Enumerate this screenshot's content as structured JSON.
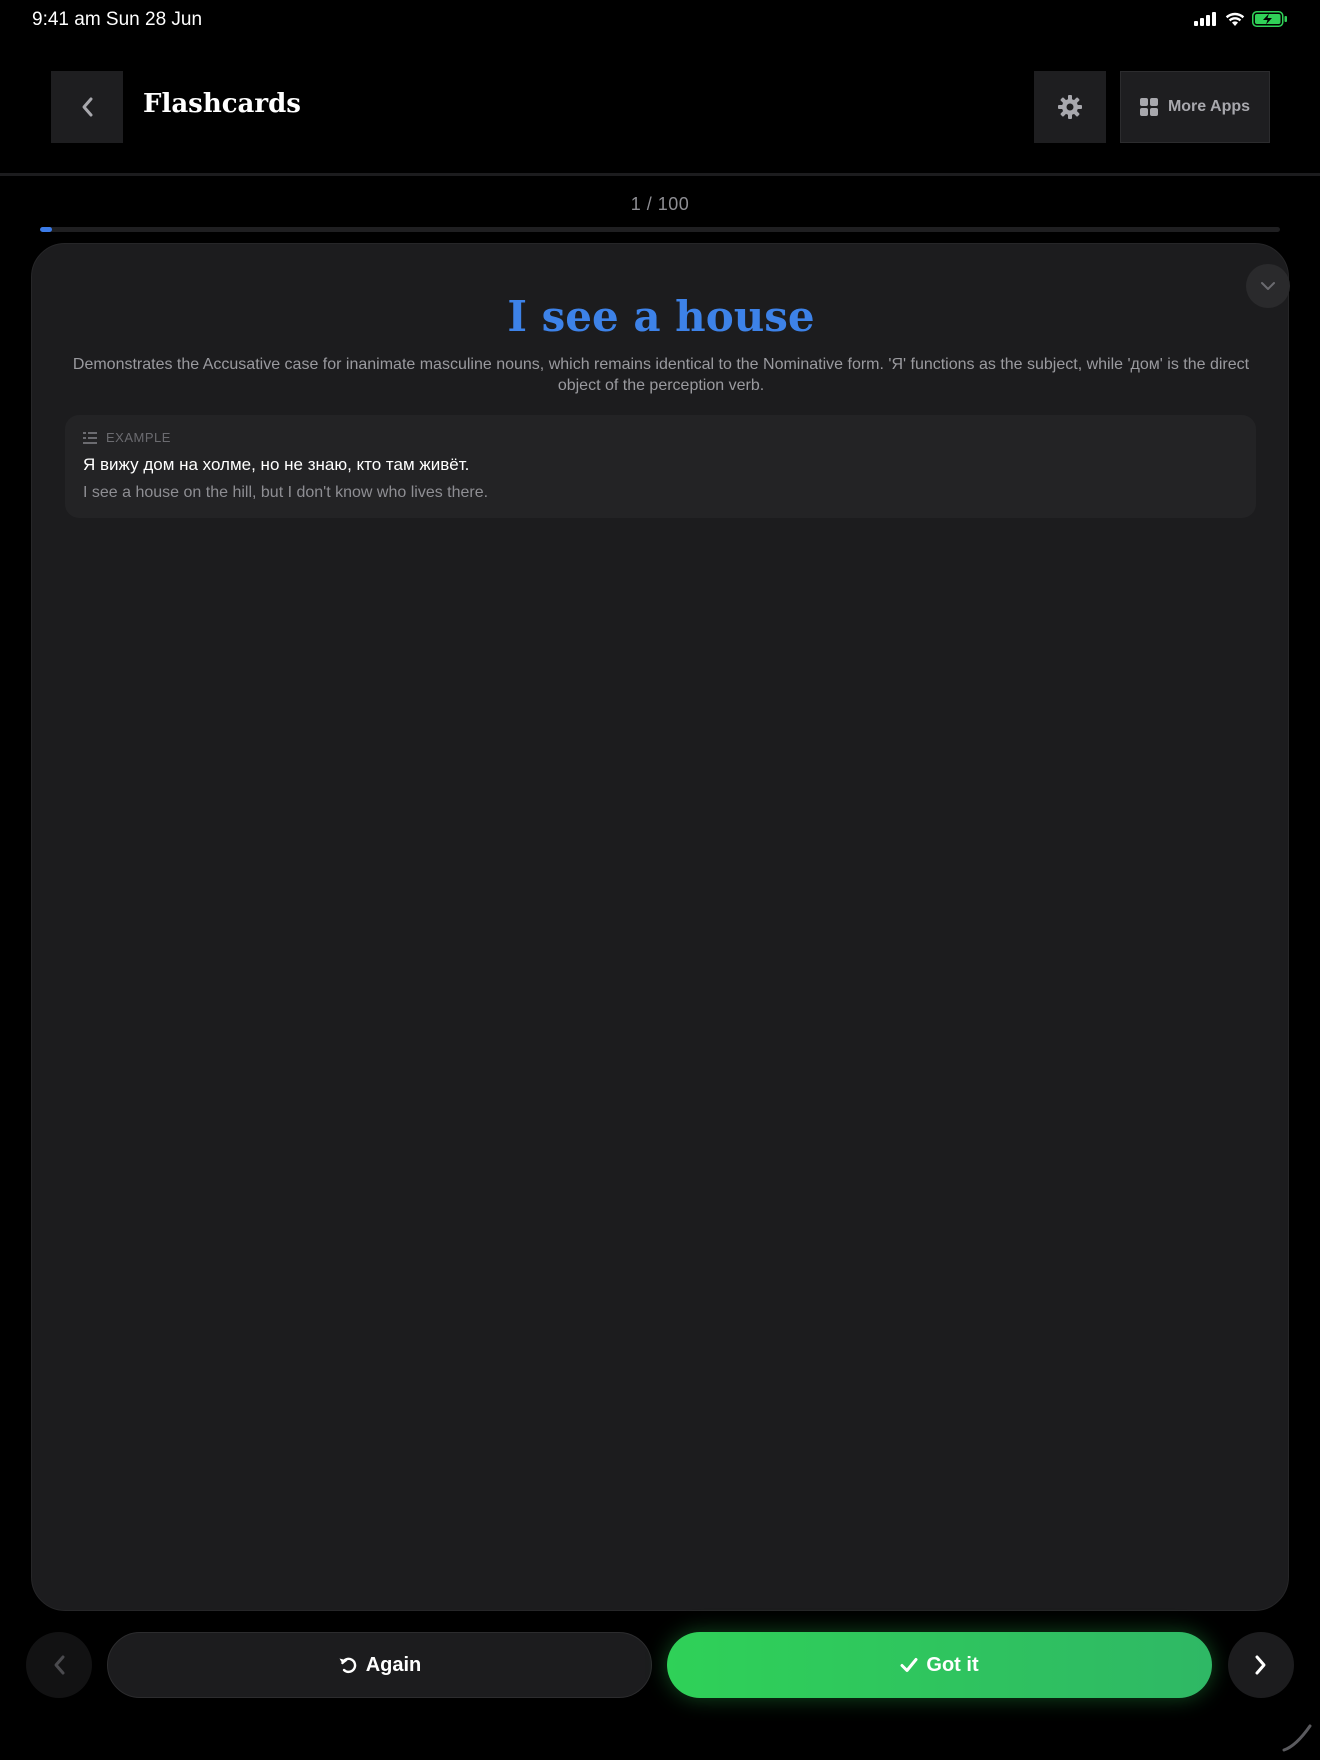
{
  "status_bar": {
    "time_date": "9:41 am   Sun 28 Jun",
    "icons": [
      "cellular-signal-icon",
      "wifi-icon",
      "battery-charging-icon"
    ],
    "battery_color": "#30d158"
  },
  "header": {
    "title": "Flashcards",
    "back_icon": "chevron-left-icon",
    "settings_icon": "gear-icon",
    "more_apps_label": "More Apps",
    "more_apps_icon": "grid-icon"
  },
  "progress": {
    "text": "1 / 100",
    "current": 1,
    "total": 100,
    "accent": "#3b7be8"
  },
  "card": {
    "title": "I see a house",
    "title_color": "#3d82e8",
    "description": "Demonstrates the Accusative case for inanimate masculine nouns, which remains identical to the Nominative form. 'Я' functions as the subject, while 'дом' is the direct object of the perception verb.",
    "collapse_icon": "chevron-down-icon",
    "example": {
      "label": "EXAMPLE",
      "icon": "example-lines-icon",
      "sentence": "Я вижу дом на холме, но не знаю, кто там живёт.",
      "translation": "I see a house on the hill, but I don't know who lives there."
    }
  },
  "actions": {
    "again_label": "Again",
    "again_icon": "rotate-left-icon",
    "gotit_label": "Got it",
    "gotit_icon": "checkmark-icon",
    "gotit_color": "#30d158",
    "prev_icon": "chevron-left-icon",
    "next_icon": "chevron-right-icon"
  }
}
